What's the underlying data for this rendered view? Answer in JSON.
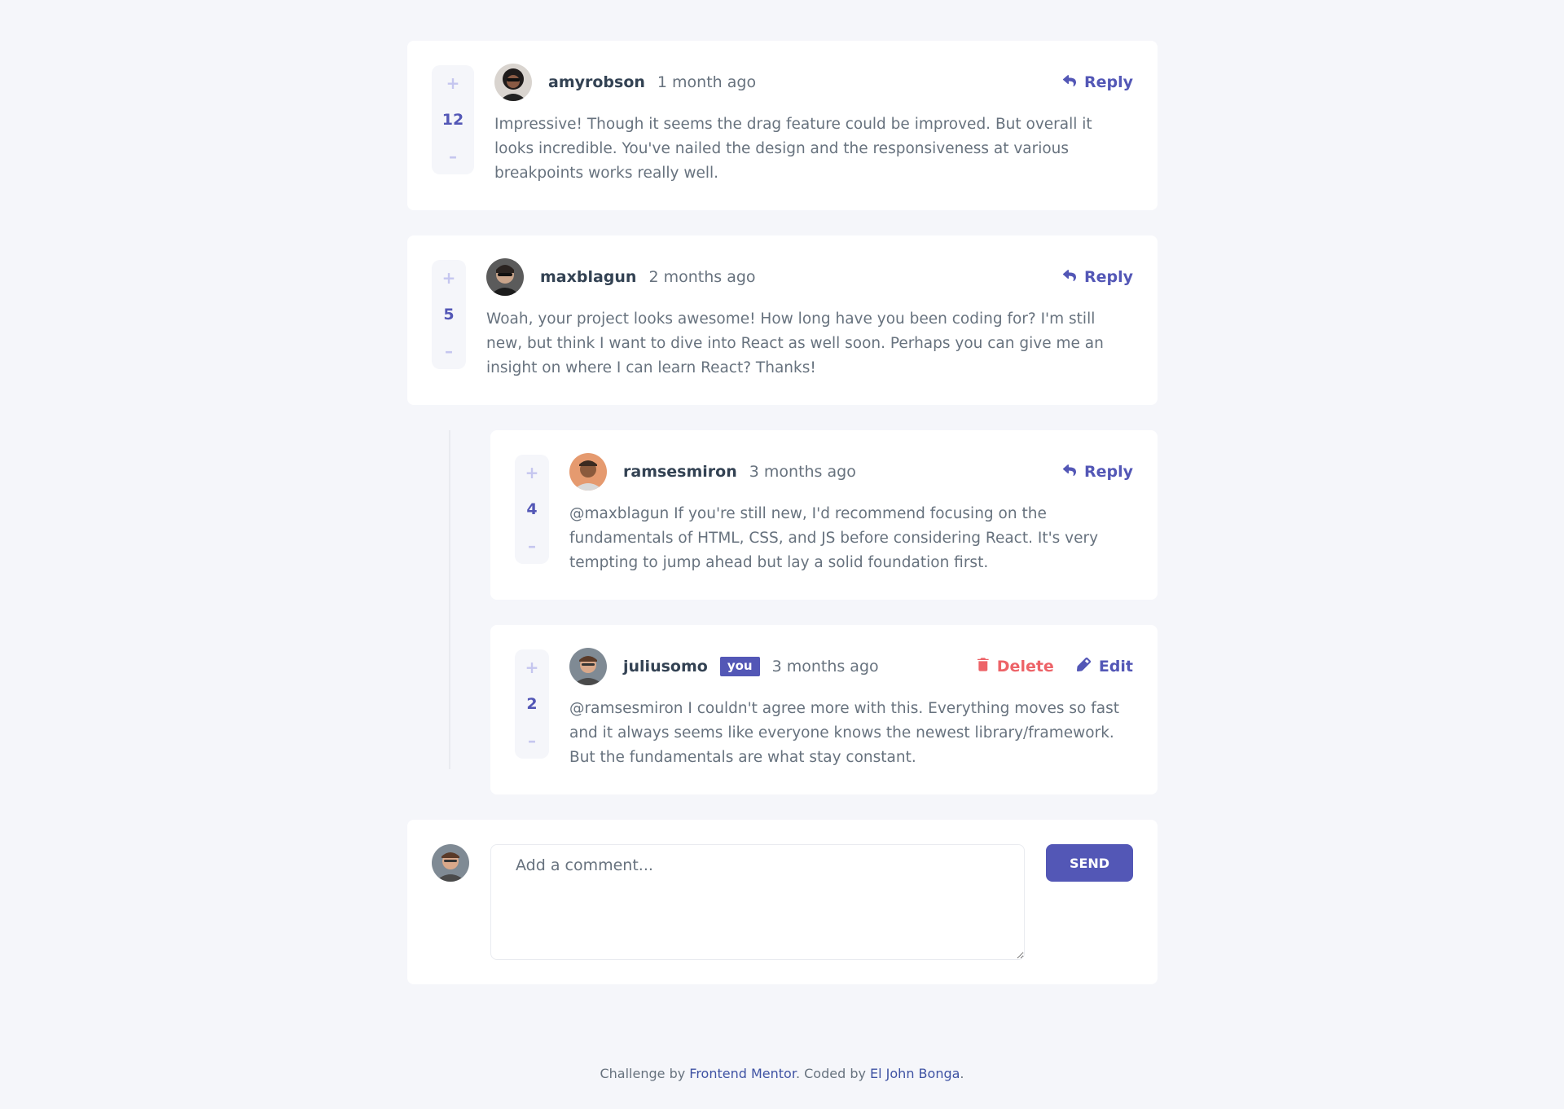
{
  "comments": [
    {
      "user": "amyrobson",
      "time": "1 month ago",
      "score": "12",
      "text": "Impressive! Though it seems the drag feature could be improved. But overall it looks incredible. You've nailed the design and the responsiveness at various breakpoints works really well.",
      "reply_label": "Reply"
    },
    {
      "user": "maxblagun",
      "time": "2 months ago",
      "score": "5",
      "text": "Woah, your project looks awesome! How long have you been coding for? I'm still new, but think I want to dive into React as well soon. Perhaps you can give me an insight on where I can learn React? Thanks!",
      "reply_label": "Reply"
    }
  ],
  "replies": [
    {
      "user": "ramsesmiron",
      "time": "3 months ago",
      "score": "4",
      "text": "@maxblagun If you're still new, I'd recommend focusing on the fundamentals of HTML, CSS, and JS before considering React. It's very tempting to jump ahead but lay a solid foundation first.",
      "reply_label": "Reply"
    },
    {
      "user": "juliusomo",
      "badge": "you",
      "time": "3 months ago",
      "score": "2",
      "text": "@ramsesmiron I couldn't agree more with this. Everything moves so fast and it always seems like everyone knows the newest library/framework. But the fundamentals are what stay constant.",
      "delete_label": "Delete",
      "edit_label": "Edit"
    }
  ],
  "vote": {
    "plus": "+",
    "minus": "–"
  },
  "composer": {
    "placeholder": "Add a comment...",
    "send_label": "SEND"
  },
  "footer": {
    "prefix": "Challenge by ",
    "link1": "Frontend Mentor",
    "middle": ". Coded by ",
    "link2": "El John Bonga",
    "suffix": "."
  },
  "colors": {
    "primary": "#5357b6",
    "danger": "#ed6368",
    "light_vote": "#c5c6ef",
    "background": "#f5f6fa",
    "heading": "#334253",
    "body_text": "#67727e"
  },
  "icons": [
    "reply-icon",
    "delete-icon",
    "edit-icon",
    "avatar-amyrobson",
    "avatar-maxblagun",
    "avatar-ramsesmiron",
    "avatar-juliusomo"
  ]
}
